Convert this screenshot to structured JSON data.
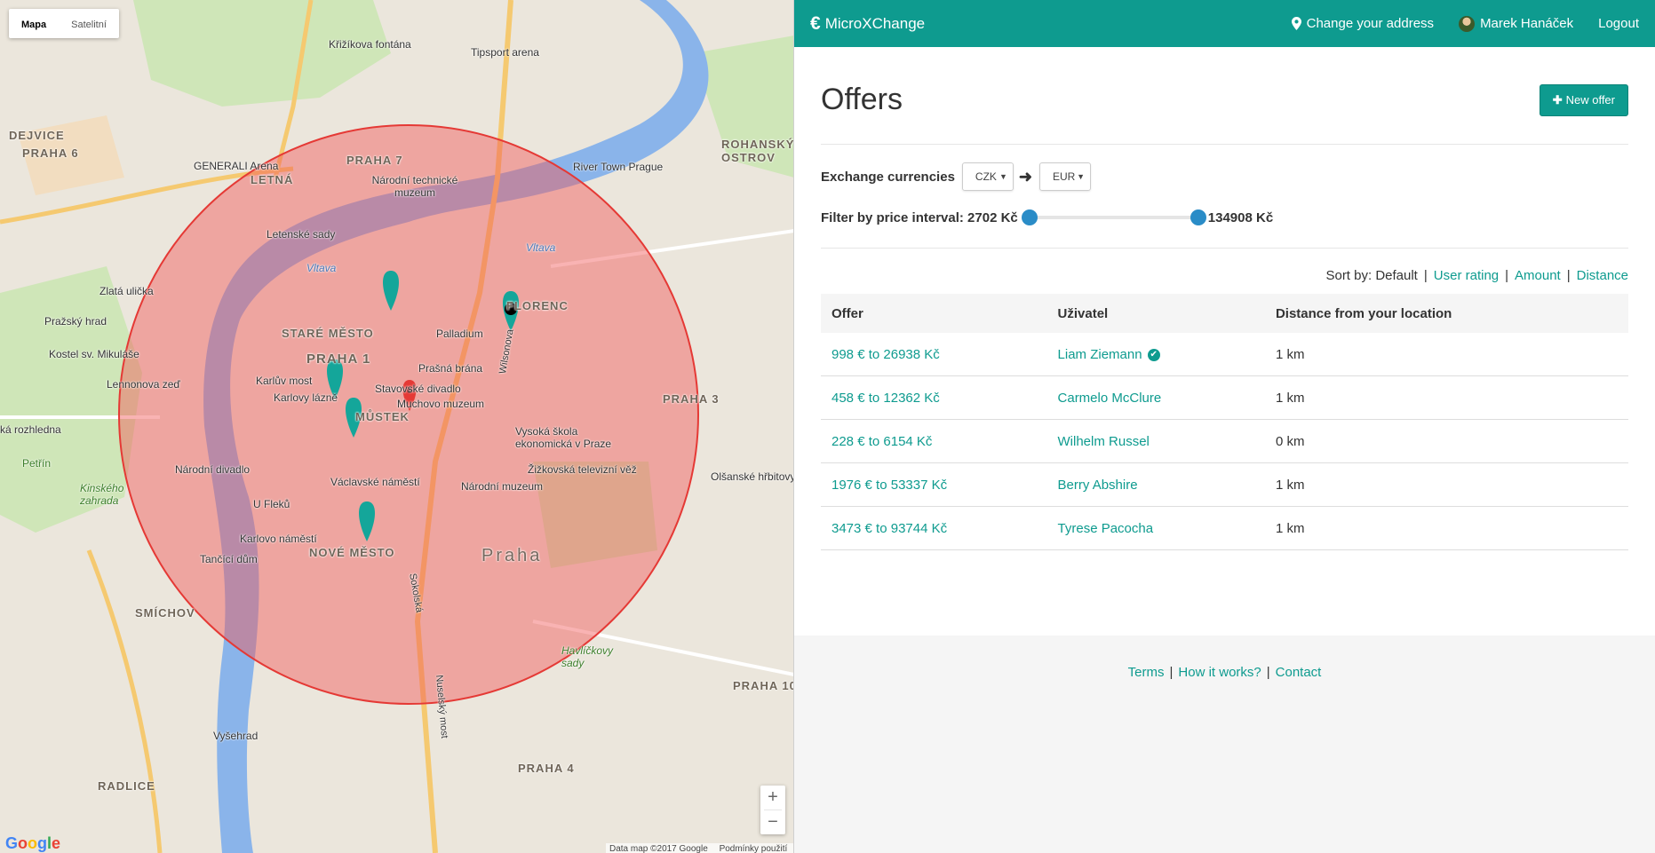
{
  "map": {
    "type_buttons": [
      "Mapa",
      "Satelitní"
    ],
    "zoom_in": "+",
    "zoom_out": "−",
    "google": "Google",
    "footer_data": "Data map ©2017 Google",
    "footer_terms": "Podmínky použití",
    "labels": {
      "dejvice": "DEJVICE",
      "praha6": "PRAHA 6",
      "letna": "LETNÁ",
      "praha7": "PRAHA 7",
      "stare_mesto": "STARÉ MĚSTO",
      "praha1": "PRAHA 1",
      "mustek": "MŮSTEK",
      "nove_mesto": "NOVÉ MĚSTO",
      "smichov": "SMÍCHOV",
      "praha": "Praha",
      "florenc": "FLORENC",
      "praha3": "PRAHA 3",
      "praha10": "PRAHA 10",
      "praha4": "PRAHA 4",
      "radlice": "RADLICE",
      "vltava1": "Vltava",
      "vltava2": "Vltava",
      "krizikova": "Křižíkova fontána",
      "tipsport": "Tipsport arena",
      "generali": "GENERALI Arena",
      "ntm": "Národní technické muzeum",
      "letenske": "Letenské sady",
      "river_town": "River Town Prague",
      "rohansky": "ROHANSKÝ OSTROV",
      "zlata": "Zlatá ulička",
      "hrad": "Pražský hrad",
      "kostel": "Kostel sv. Mikuláše",
      "lennon": "Lennonova zeď",
      "karluv": "Karlův most",
      "lazne": "Karlovy lázně",
      "palladium": "Palladium",
      "prasna": "Prašná brána",
      "stavovske": "Stavovské divadlo",
      "muchovo": "Muchovo muzeum",
      "vse": "Vysoká škola ekonomická v Praze",
      "tv_tower": "Žižkovská televizní věž",
      "narodni_div": "Národní divadlo",
      "vaclavske": "Václavské náměstí",
      "nar_muzeum": "Národní muzeum",
      "u_fleku": "U Fleků",
      "karlovo": "Karlovo náměstí",
      "tancici": "Tančící dům",
      "petrin": "Petřín",
      "kinskeho": "Kinského zahrada",
      "vysehrad": "Vyšehrad",
      "havlickovy": "Havlíčkovy sady",
      "olsanske": "Olšanské hřbitovy",
      "rozhledna": "ká rozhledna",
      "wilsonova": "Wilsonova",
      "sokolska": "Sokolská",
      "nusle": "Nuselský most"
    }
  },
  "nav": {
    "brand_icon": "€",
    "brand": "MicroXChange",
    "change_address": "Change your address",
    "user": "Marek Hanáček",
    "logout": "Logout"
  },
  "page": {
    "title": "Offers",
    "new_offer": "New offer",
    "exchange_label": "Exchange currencies",
    "from_currency": "CZK",
    "to_currency": "EUR",
    "filter_label": "Filter by price interval: 2702 Kč",
    "filter_max": "134908 Kč",
    "filter_min_value": 2702,
    "filter_max_value": 134908,
    "sort_label": "Sort by: Default",
    "sort_options": [
      "User rating",
      "Amount",
      "Distance"
    ],
    "table_headers": [
      "Offer",
      "Uživatel",
      "Distance from your location"
    ],
    "rows": [
      {
        "offer": "998 € to 26938 Kč",
        "user": "Liam Ziemann",
        "verified": true,
        "distance": "1 km"
      },
      {
        "offer": "458 € to 12362 Kč",
        "user": "Carmelo McClure",
        "verified": false,
        "distance": "1 km"
      },
      {
        "offer": "228 € to 6154 Kč",
        "user": "Wilhelm Russel",
        "verified": false,
        "distance": "0 km"
      },
      {
        "offer": "1976 € to 53337 Kč",
        "user": "Berry Abshire",
        "verified": false,
        "distance": "1 km"
      },
      {
        "offer": "3473 € to 93744 Kč",
        "user": "Tyrese Pacocha",
        "verified": false,
        "distance": "1 km"
      }
    ]
  },
  "footer": {
    "terms": "Terms",
    "how": "How it works?",
    "contact": "Contact"
  },
  "colors": {
    "accent": "#0e9b8f",
    "circle": "#e53935",
    "slider": "#2a8cc7"
  }
}
